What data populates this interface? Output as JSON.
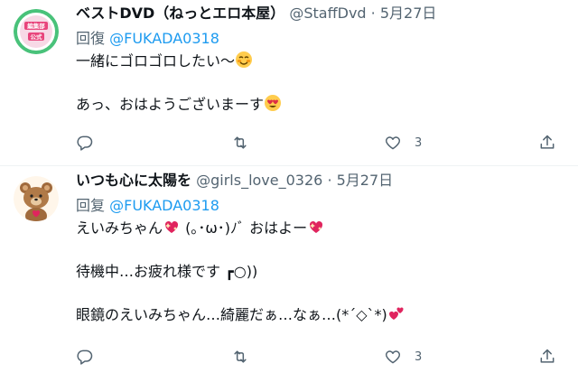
{
  "tweets": [
    {
      "name": "ベストDVD（ねっとエロ本屋）",
      "handle": "@StaffDvd",
      "separator": "·",
      "date": "5月27日",
      "reply_prefix": "回復",
      "reply_to": "@FUKADA0318",
      "lines": [
        "一緒にゴロゴロしたい〜",
        "",
        "あっ、おはようございまーす"
      ],
      "like_count": "3",
      "avatar_label": "編集部公式"
    },
    {
      "name": "いつも心に太陽を",
      "handle": "@girls_love_0326",
      "separator": "·",
      "date": "5月27日",
      "reply_prefix": "回复",
      "reply_to": "@FUKADA0318",
      "lines": [
        "えいみちゃん",
        "(｡･ω･)ﾉﾞ おはよー",
        "",
        "待機中…お疲れ様です",
        "┏○))",
        "",
        "眼鏡のえいみちゃん…綺麗だぁ…なぁ…(*´◇`*)"
      ],
      "like_count": "3"
    }
  ],
  "colors": {
    "accent": "#1d9bf0",
    "muted": "#536471",
    "text": "#0f1419",
    "divider": "#eff3f4"
  },
  "icons": [
    "reply-icon",
    "retweet-icon",
    "like-icon",
    "share-icon"
  ]
}
